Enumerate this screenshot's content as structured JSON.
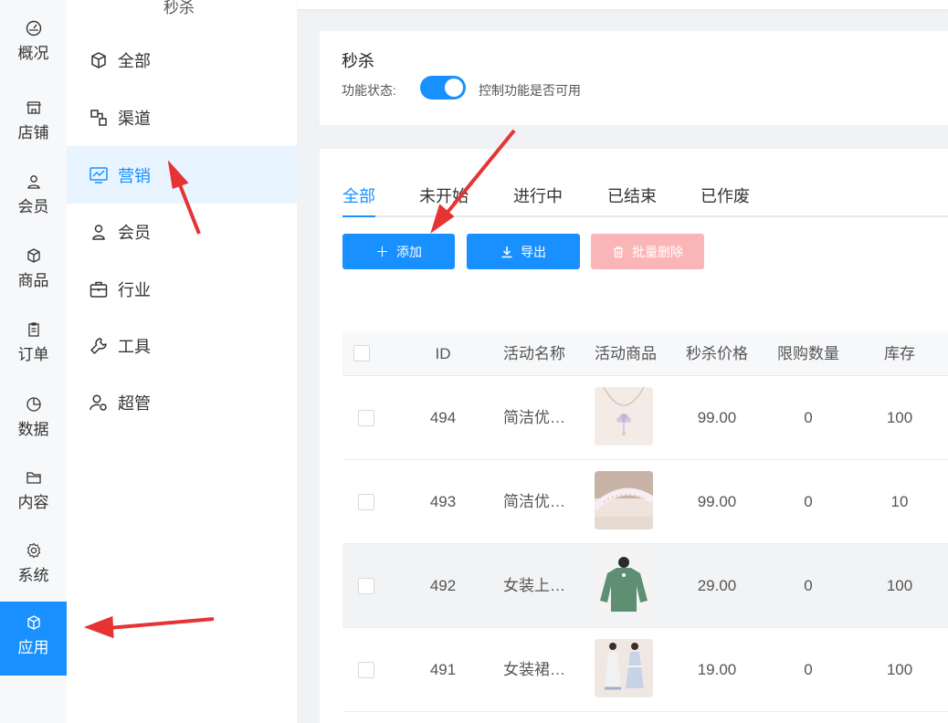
{
  "rail": {
    "items": [
      {
        "label": "概况",
        "icon": "dashboard-icon"
      },
      {
        "label": "店铺",
        "icon": "store-icon"
      },
      {
        "label": "会员",
        "icon": "user-icon"
      },
      {
        "label": "商品",
        "icon": "box-icon"
      },
      {
        "label": "订单",
        "icon": "clipboard-icon"
      },
      {
        "label": "数据",
        "icon": "pie-chart-icon"
      },
      {
        "label": "内容",
        "icon": "folder-icon"
      },
      {
        "label": "系统",
        "icon": "gear-icon"
      },
      {
        "label": "应用",
        "icon": "cube-icon"
      }
    ],
    "active_index": 8
  },
  "sub": {
    "title": "秒杀",
    "items": [
      {
        "label": "全部",
        "icon": "cube-icon"
      },
      {
        "label": "渠道",
        "icon": "channel-icon"
      },
      {
        "label": "营销",
        "icon": "marketing-chart-icon"
      },
      {
        "label": "会员",
        "icon": "user-icon"
      },
      {
        "label": "行业",
        "icon": "briefcase-icon"
      },
      {
        "label": "工具",
        "icon": "wrench-icon"
      },
      {
        "label": "超管",
        "icon": "admin-user-icon"
      }
    ],
    "active_index": 2
  },
  "feature": {
    "title": "秒杀",
    "state_label": "功能状态:",
    "enabled": true,
    "hint": "控制功能是否可用"
  },
  "tabs": [
    {
      "label": "全部"
    },
    {
      "label": "未开始"
    },
    {
      "label": "进行中"
    },
    {
      "label": "已结束"
    },
    {
      "label": "已作废"
    }
  ],
  "buttons": {
    "add": "添加",
    "export": "导出",
    "batch_delete": "批量删除"
  },
  "table": {
    "headers": [
      "ID",
      "活动名称",
      "活动商品",
      "秒杀价格",
      "限购数量",
      "库存"
    ],
    "rows": [
      {
        "id": "494",
        "name": "简洁优…",
        "image": "necklace-product-image",
        "price": "99.00",
        "limit": "0",
        "stock": "100"
      },
      {
        "id": "493",
        "name": "简洁优…",
        "image": "bracelet-product-image",
        "price": "99.00",
        "limit": "0",
        "stock": "10"
      },
      {
        "id": "492",
        "name": "女装上…",
        "image": "green-sweater-product-image",
        "price": "29.00",
        "limit": "0",
        "stock": "100"
      },
      {
        "id": "491",
        "name": "女装裙…",
        "image": "dress-product-image",
        "price": "19.00",
        "limit": "0",
        "stock": "100"
      }
    ]
  },
  "colors": {
    "primary": "#1890ff",
    "danger_disabled": "#fab6b6",
    "annotation_arrow": "#e63333"
  }
}
